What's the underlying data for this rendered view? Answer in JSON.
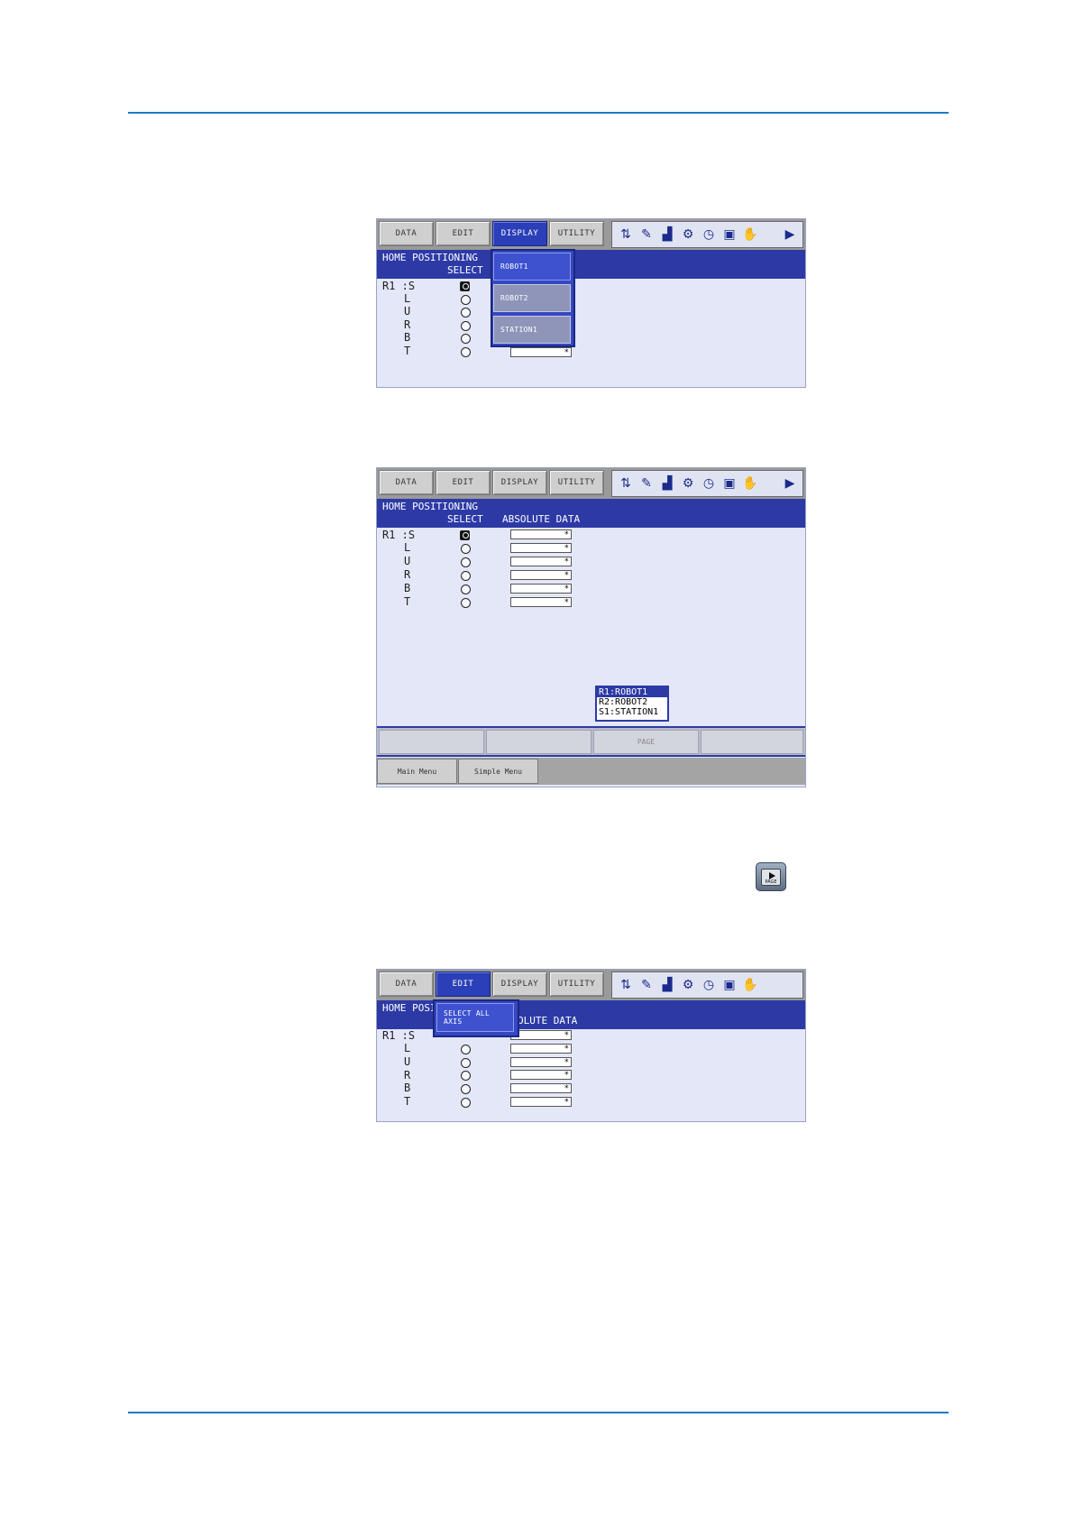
{
  "menu": {
    "data": "DATA",
    "edit": "EDIT",
    "display": "DISPLAY",
    "utility": "UTILITY"
  },
  "screen": {
    "title": "HOME POSITIONING",
    "col_select": "SELECT",
    "col_absolute": "ABSOLUTE DATA",
    "col_absolute_partial": "OLUTE DATA",
    "title_partial": "HOME POSI",
    "axes": [
      "R1 :S",
      "L",
      "U",
      "R",
      "B",
      "T"
    ],
    "field_value": "*"
  },
  "display_menu": {
    "items": [
      "ROBOT1",
      "ROBOT2",
      "STATION1"
    ]
  },
  "edit_menu": {
    "select_all_line1": "SELECT ALL",
    "select_all_line2": "AXIS"
  },
  "group_list": [
    "R1:ROBOT1",
    "R2:ROBOT2",
    "S1:STATION1"
  ],
  "function_keys": {
    "page": "PAGE"
  },
  "bottom": {
    "main_menu": "Main Menu",
    "simple_menu": "Simple Menu"
  },
  "page_key": {
    "label": "PAGE"
  },
  "icons": [
    "axis-icon",
    "edit-icon",
    "signal-icon",
    "tool-icon",
    "timer-icon",
    "monitor-icon",
    "hand-icon",
    "page-arrow-icon"
  ]
}
